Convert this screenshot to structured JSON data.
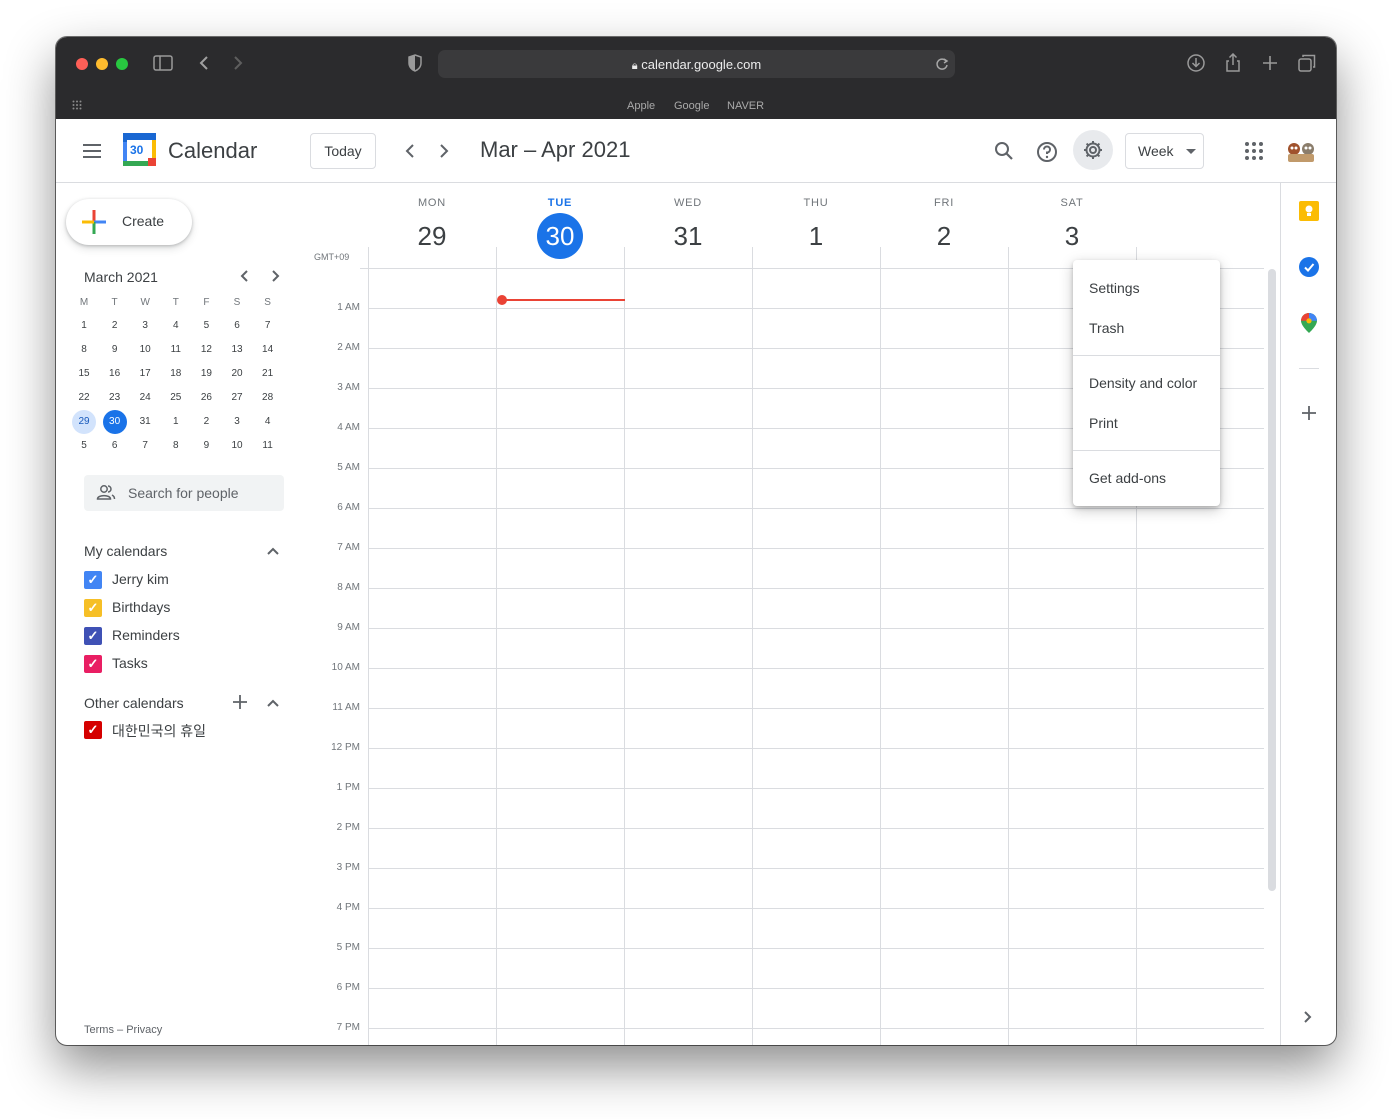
{
  "browser": {
    "url": "calendar.google.com",
    "favorites": [
      "Apple",
      "Google",
      "NAVER"
    ]
  },
  "header": {
    "app_name": "Calendar",
    "logo_number": "30",
    "today_label": "Today",
    "date_range": "Mar – Apr 2021",
    "view_label": "Week"
  },
  "sidebar": {
    "create_label": "Create",
    "mini_month": "March 2021",
    "weekday_initials": [
      "M",
      "T",
      "W",
      "T",
      "F",
      "S",
      "S"
    ],
    "weeks": [
      [
        "1",
        "2",
        "3",
        "4",
        "5",
        "6",
        "7"
      ],
      [
        "8",
        "9",
        "10",
        "11",
        "12",
        "13",
        "14"
      ],
      [
        "15",
        "16",
        "17",
        "18",
        "19",
        "20",
        "21"
      ],
      [
        "22",
        "23",
        "24",
        "25",
        "26",
        "27",
        "28"
      ],
      [
        "29",
        "30",
        "31",
        "1",
        "2",
        "3",
        "4"
      ],
      [
        "5",
        "6",
        "7",
        "8",
        "9",
        "10",
        "11"
      ]
    ],
    "search_placeholder": "Search for people",
    "my_calendars_title": "My calendars",
    "my_calendars": [
      {
        "label": "Jerry kim",
        "color": "#4285f4"
      },
      {
        "label": "Birthdays",
        "color": "#f6bf26"
      },
      {
        "label": "Reminders",
        "color": "#3f51b5"
      },
      {
        "label": "Tasks",
        "color": "#e91e63"
      }
    ],
    "other_calendars_title": "Other calendars",
    "other_calendars": [
      {
        "label": "대한민국의 휴일",
        "color": "#d50000"
      }
    ],
    "footer_terms": "Terms",
    "footer_sep": "–",
    "footer_privacy": "Privacy"
  },
  "week": {
    "timezone": "GMT+09",
    "days": [
      {
        "dow": "MON",
        "num": "29"
      },
      {
        "dow": "TUE",
        "num": "30"
      },
      {
        "dow": "WED",
        "num": "31"
      },
      {
        "dow": "THU",
        "num": "1"
      },
      {
        "dow": "FRI",
        "num": "2"
      },
      {
        "dow": "SAT",
        "num": "3"
      }
    ],
    "hours": [
      "1 AM",
      "2 AM",
      "3 AM",
      "4 AM",
      "5 AM",
      "6 AM",
      "7 AM",
      "8 AM",
      "9 AM",
      "10 AM",
      "11 AM",
      "12 PM",
      "1 PM",
      "2 PM",
      "3 PM",
      "4 PM",
      "5 PM",
      "6 PM",
      "7 PM"
    ]
  },
  "settings_menu": {
    "items": [
      "Settings",
      "Trash",
      "Density and color",
      "Print",
      "Get add-ons"
    ]
  },
  "colors": {
    "accent": "#1a73e8",
    "now_line": "#ea4335"
  }
}
